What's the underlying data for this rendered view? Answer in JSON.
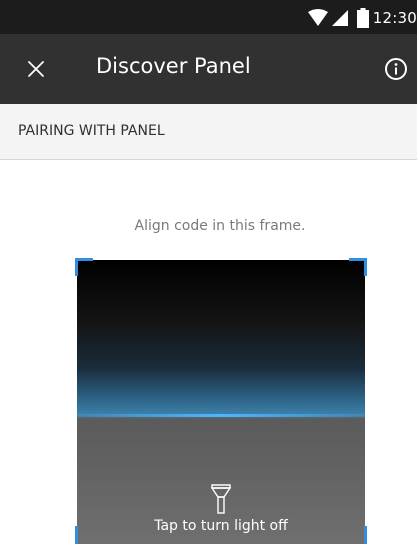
{
  "status_bar": {
    "time": "12:30",
    "icons": [
      "wifi-icon",
      "cellular-signal-icon",
      "battery-icon"
    ]
  },
  "app_bar": {
    "title": "Discover Panel",
    "close_icon": "close-icon",
    "info_icon": "info-icon"
  },
  "subheader": {
    "label": "PAIRING WITH PANEL"
  },
  "scanner": {
    "instruction": "Align code in this frame.",
    "flash_icon": "flashlight-icon",
    "flash_label": "Tap to turn light off",
    "accent_color": "#2f8fe0"
  },
  "colors": {
    "status_bar": "#1c1c1c",
    "app_bar": "#313131",
    "subheader_bg": "#f4f4f4"
  }
}
